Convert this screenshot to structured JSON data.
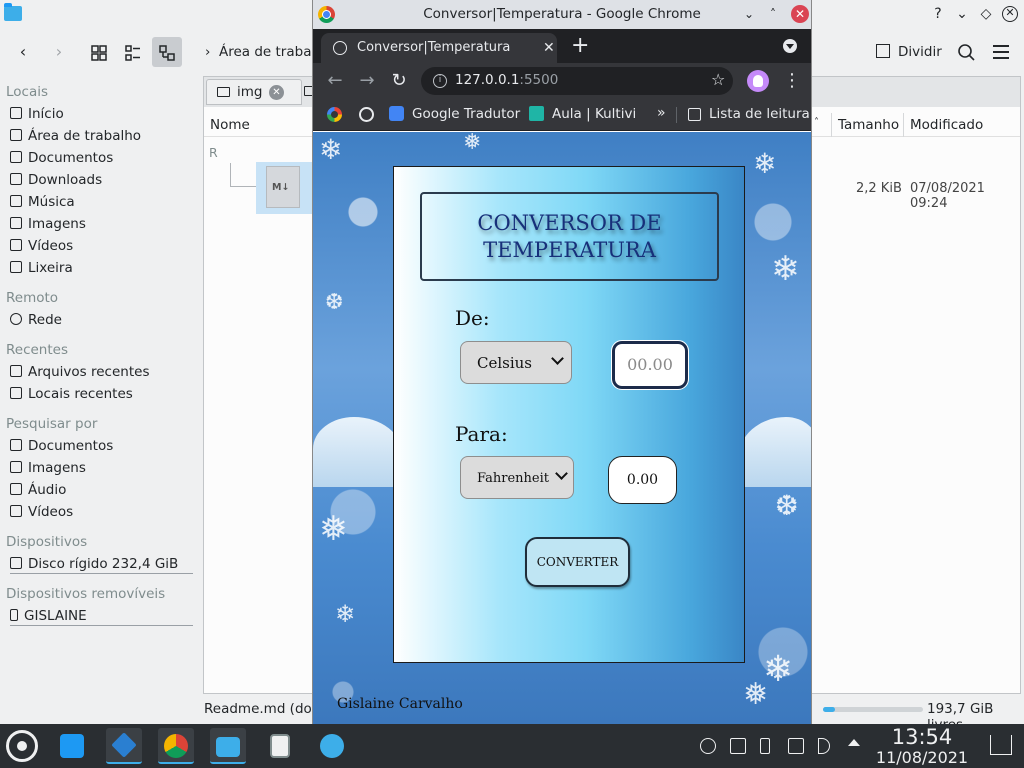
{
  "file_manager": {
    "breadcrumb": "Área de trabalh",
    "toolbar": {
      "split_label": "Dividir"
    },
    "places": {
      "sections": [
        {
          "title": "Locais",
          "items": [
            "Início",
            "Área de trabalho",
            "Documentos",
            "Downloads",
            "Música",
            "Imagens",
            "Vídeos",
            "Lixeira"
          ]
        },
        {
          "title": "Remoto",
          "items": [
            "Rede"
          ]
        },
        {
          "title": "Recentes",
          "items": [
            "Arquivos recentes",
            "Locais recentes"
          ]
        },
        {
          "title": "Pesquisar por",
          "items": [
            "Documentos",
            "Imagens",
            "Áudio",
            "Vídeos"
          ]
        },
        {
          "title": "Dispositivos",
          "items": [
            "Disco rígido 232,4 GiB"
          ]
        },
        {
          "title": "Dispositivos removíveis",
          "items": [
            "GISLAINE"
          ]
        }
      ]
    },
    "tabs": [
      {
        "label": "img"
      }
    ],
    "columns": {
      "name": "Nome",
      "size": "Tamanho",
      "modified": "Modificado"
    },
    "group_label": "R",
    "file": {
      "icon_text": "M↓",
      "size": "2,2 KiB",
      "modified": "07/08/2021 09:24"
    },
    "status": {
      "text": "Readme.md (docu",
      "free_space": "193,7 GiB livres",
      "used_fraction": 0.12
    }
  },
  "chrome": {
    "window_title": "Conversor|Temperatura - Google Chrome",
    "tab_title": "Conversor|Temperatura",
    "url_host": "127.0.0.1",
    "url_port": ":5500",
    "bookmarks": [
      "Google Tradutor",
      "Aula | Kultivi"
    ],
    "reading_list": "Lista de leitura"
  },
  "page": {
    "title_line1": "CONVERSOR DE",
    "title_line2": "TEMPERATURA",
    "from_label": "De:",
    "from_unit": "Celsius",
    "from_placeholder": "00.00",
    "to_label": "Para:",
    "to_unit": "Fahrenheit",
    "result": "0.00",
    "convert_label": "CONVERTER",
    "footer": "Gislaine Carvalho"
  },
  "taskbar": {
    "time": "13:54",
    "date": "11/08/2021"
  },
  "colors": {
    "accent": "#3daee9",
    "title_text": "#17307a",
    "close_red": "#da4453"
  }
}
